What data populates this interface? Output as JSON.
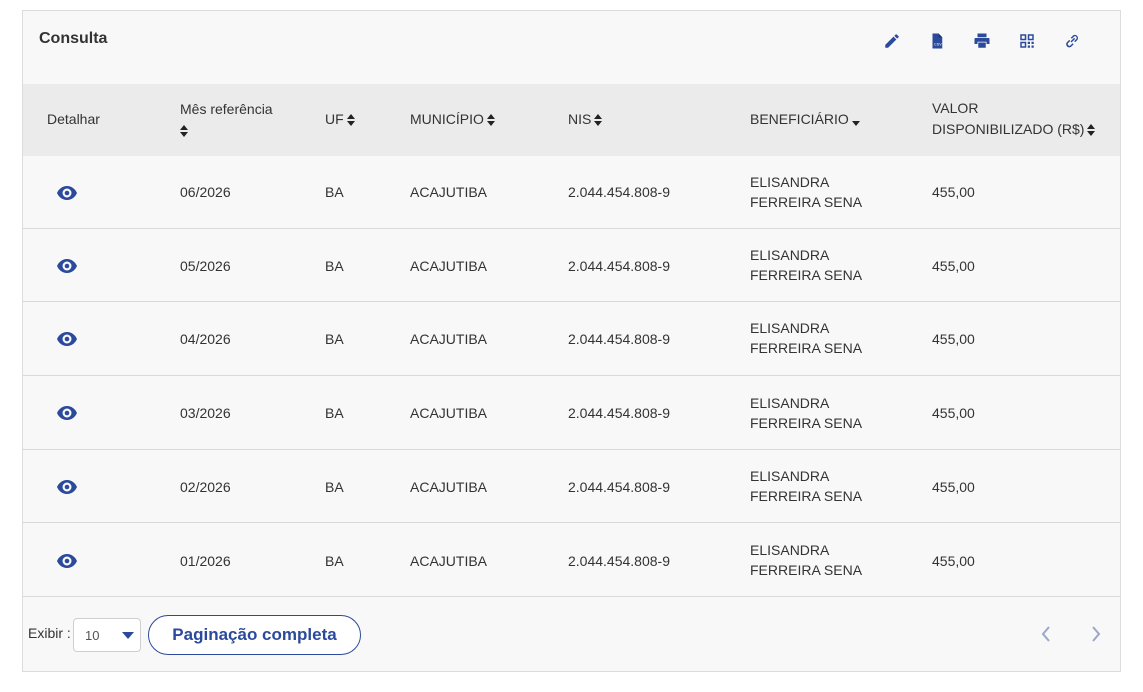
{
  "panel": {
    "title": "Consulta",
    "toolbar_icons": [
      "edit-icon",
      "csv-file-icon",
      "print-icon",
      "qr-code-icon",
      "link-icon"
    ]
  },
  "table": {
    "headers": {
      "detalhar": "Detalhar",
      "mes_referencia": "Mês referência",
      "uf": "UF",
      "municipio": "MUNICÍPIO",
      "nis": "NIS",
      "beneficiario": "BENEFICIÁRIO",
      "valor_line1": "VALOR",
      "valor_line2": "DISPONIBILIZADO (R$)"
    },
    "rows": [
      {
        "mes": "06/2026",
        "uf": "BA",
        "municipio": "ACAJUTIBA",
        "nis": "2.044.454.808-9",
        "beneficiario_1": "ELISANDRA",
        "beneficiario_2": "FERREIRA SENA",
        "valor": "455,00"
      },
      {
        "mes": "05/2026",
        "uf": "BA",
        "municipio": "ACAJUTIBA",
        "nis": "2.044.454.808-9",
        "beneficiario_1": "ELISANDRA",
        "beneficiario_2": "FERREIRA SENA",
        "valor": "455,00"
      },
      {
        "mes": "04/2026",
        "uf": "BA",
        "municipio": "ACAJUTIBA",
        "nis": "2.044.454.808-9",
        "beneficiario_1": "ELISANDRA",
        "beneficiario_2": "FERREIRA SENA",
        "valor": "455,00"
      },
      {
        "mes": "03/2026",
        "uf": "BA",
        "municipio": "ACAJUTIBA",
        "nis": "2.044.454.808-9",
        "beneficiario_1": "ELISANDRA",
        "beneficiario_2": "FERREIRA SENA",
        "valor": "455,00"
      },
      {
        "mes": "02/2026",
        "uf": "BA",
        "municipio": "ACAJUTIBA",
        "nis": "2.044.454.808-9",
        "beneficiario_1": "ELISANDRA",
        "beneficiario_2": "FERREIRA SENA",
        "valor": "455,00"
      },
      {
        "mes": "01/2026",
        "uf": "BA",
        "municipio": "ACAJUTIBA",
        "nis": "2.044.454.808-9",
        "beneficiario_1": "ELISANDRA",
        "beneficiario_2": "FERREIRA SENA",
        "valor": "455,00"
      }
    ]
  },
  "footer": {
    "exibir_label": "Exibir :",
    "page_size": "10",
    "paginacao_label": "Paginação completa"
  },
  "colors": {
    "accent": "#2b4a9c",
    "header_bg": "#ebebeb",
    "panel_bg": "#f8f8f8"
  }
}
